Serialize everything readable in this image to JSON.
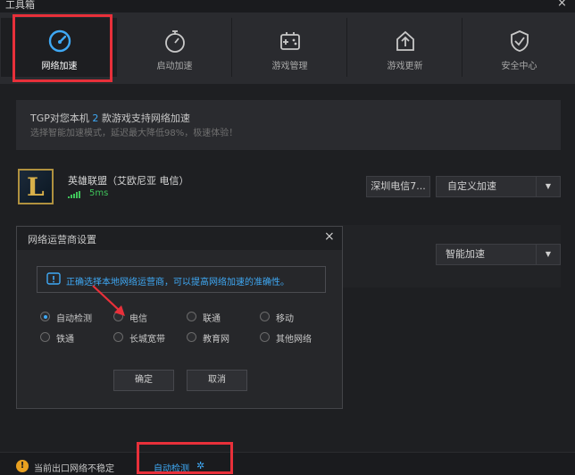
{
  "window": {
    "title": "工具箱",
    "close": "×"
  },
  "nav": {
    "tabs": [
      {
        "label": "网络加速",
        "icon": "speedometer-icon",
        "active": true
      },
      {
        "label": "启动加速",
        "icon": "stopwatch-icon",
        "active": false
      },
      {
        "label": "游戏管理",
        "icon": "gamepad-icon",
        "active": false
      },
      {
        "label": "游戏更新",
        "icon": "upload-icon",
        "active": false
      },
      {
        "label": "安全中心",
        "icon": "shield-check-icon",
        "active": false
      }
    ]
  },
  "info": {
    "line1_prefix": "TGP对您本机",
    "line1_count": "2",
    "line1_suffix": "款游戏支持网络加速",
    "line2": "选择智能加速模式，延迟最大降低98%，极速体验！"
  },
  "game": {
    "name": "英雄联盟（艾欧尼亚 电信）",
    "ping": "5ms",
    "server_button": "深圳电信7...",
    "mode_select": "自定义加速",
    "mode_select2": "智能加速"
  },
  "dialog": {
    "title": "网络运营商设置",
    "close": "×",
    "notice": "正确选择本地网络运营商，可以提高网络加速的准确性。",
    "options": [
      {
        "label": "自动检测",
        "selected": true
      },
      {
        "label": "电信",
        "selected": false
      },
      {
        "label": "联通",
        "selected": false
      },
      {
        "label": "移动",
        "selected": false
      },
      {
        "label": "铁通",
        "selected": false
      },
      {
        "label": "长城宽带",
        "selected": false
      },
      {
        "label": "教育网",
        "selected": false
      },
      {
        "label": "其他网络",
        "selected": false
      }
    ],
    "ok": "确定",
    "cancel": "取消"
  },
  "status": {
    "warning": "当前出口网络不稳定",
    "auto_detect": "自动检测"
  },
  "colors": {
    "accent": "#3fa9f5",
    "highlight": "#e8303a",
    "ping": "#3fc35a",
    "warning": "#e8a020"
  }
}
